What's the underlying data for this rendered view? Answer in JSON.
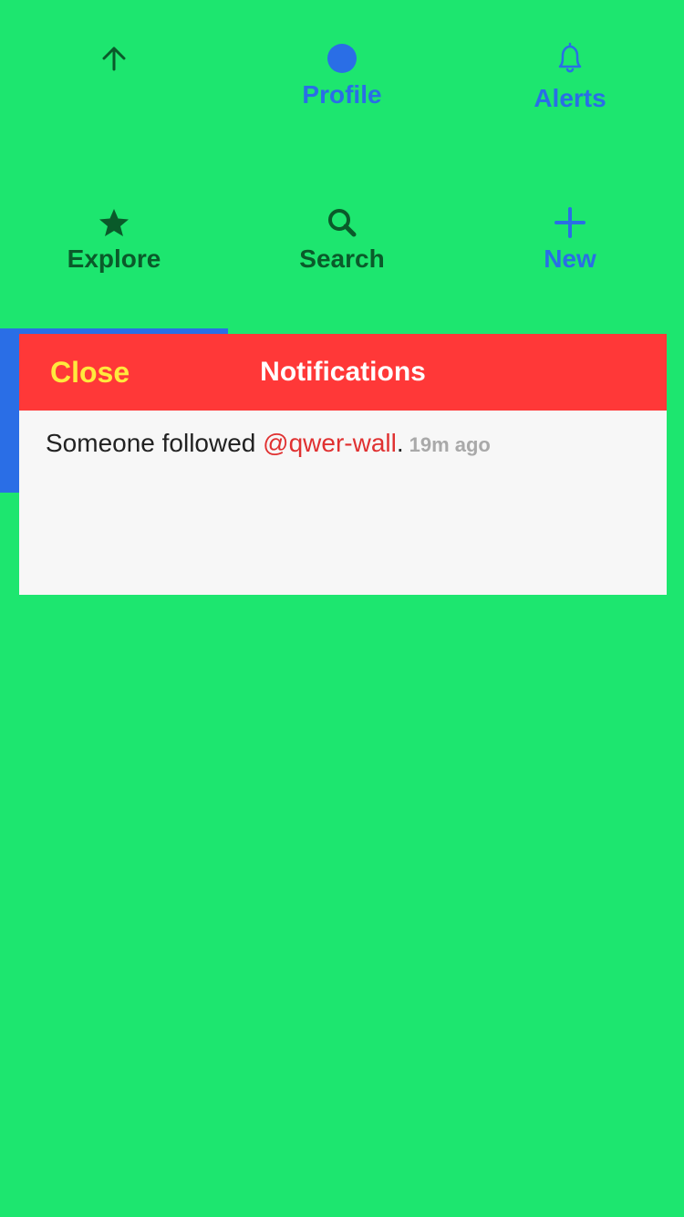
{
  "nav": {
    "row1": [
      {
        "id": "up",
        "label": "",
        "icon": "arrow-up-icon"
      },
      {
        "id": "profile",
        "label": "Profile",
        "icon": "profile-circle-icon"
      },
      {
        "id": "alerts",
        "label": "Alerts",
        "icon": "bell-icon"
      }
    ],
    "row2": [
      {
        "id": "explore",
        "label": "Explore",
        "icon": "star-icon"
      },
      {
        "id": "search",
        "label": "Search",
        "icon": "search-icon"
      },
      {
        "id": "new",
        "label": "New",
        "icon": "plus-icon"
      }
    ]
  },
  "panel": {
    "close_label": "Close",
    "title": "Notifications",
    "notifications": [
      {
        "text": "Someone followed ",
        "handle": "@qwer-wall",
        "suffix": ".",
        "time": "19m ago"
      }
    ]
  },
  "colors": {
    "background": "#1de66f",
    "accent_blue": "#2a6ee6",
    "dark_green": "#0a5a2a",
    "header_red": "#ff3838",
    "close_yellow": "#ffe93d",
    "handle_red": "#e03131",
    "time_gray": "#a9a9a9"
  }
}
